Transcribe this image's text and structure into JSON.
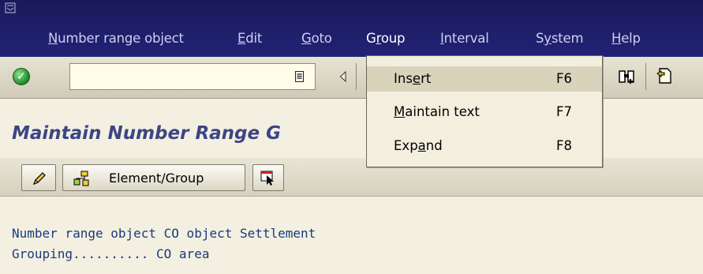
{
  "menubar": {
    "items": [
      {
        "pre": "",
        "u": "N",
        "post": "umber range object"
      },
      {
        "pre": "",
        "u": "E",
        "post": "dit"
      },
      {
        "pre": "",
        "u": "G",
        "post": "oto"
      },
      {
        "pre": "G",
        "u": "r",
        "post": "oup"
      },
      {
        "pre": "",
        "u": "I",
        "post": "nterval"
      },
      {
        "pre": "S",
        "u": "y",
        "post": "stem"
      },
      {
        "pre": "",
        "u": "H",
        "post": "elp"
      }
    ]
  },
  "toolbar": {
    "command_field_value": "",
    "ok_icon": "checkmark-icon"
  },
  "page": {
    "title": "Maintain Number Range G"
  },
  "app_toolbar": {
    "element_group_label": "Element/Group"
  },
  "content": {
    "line1": "Number range object CO object Settlement",
    "line2": "Grouping.......... CO area"
  },
  "group_menu": {
    "items": [
      {
        "pre": "Ins",
        "u": "e",
        "post": "rt",
        "key": "F6",
        "highlighted": true
      },
      {
        "pre": "",
        "u": "M",
        "post": "aintain text",
        "key": "F7",
        "highlighted": false
      },
      {
        "pre": "Exp",
        "u": "a",
        "post": "nd",
        "key": "F8",
        "highlighted": false
      }
    ]
  },
  "colors": {
    "menubar_bg": "#222276",
    "title": "#3c4584",
    "content_text": "#1a3a7a"
  }
}
